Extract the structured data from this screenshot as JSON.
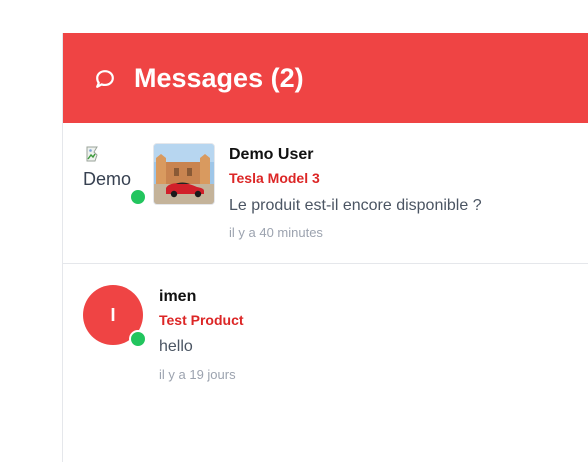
{
  "header": {
    "icon": "chat-bubble-icon",
    "title": "Messages (2)",
    "background_color": "#ef4444"
  },
  "conversations": [
    {
      "avatar_alt": "Demo",
      "avatar_icon": "broken-image-icon",
      "online": true,
      "product_thumbnail": "red-car-photo",
      "user_name": "Demo User",
      "product_name": "Tesla Model 3",
      "last_message": "Le produit est-il encore disponible ?",
      "time_ago": "il y a 40 minutes"
    },
    {
      "avatar_initial": "I",
      "online": true,
      "user_name": "imen",
      "product_name": "Test Product",
      "last_message": "hello",
      "time_ago": "il y a 19 jours"
    }
  ],
  "colors": {
    "accent": "#ef4444",
    "product_text": "#dc2626",
    "online": "#22c55e"
  }
}
